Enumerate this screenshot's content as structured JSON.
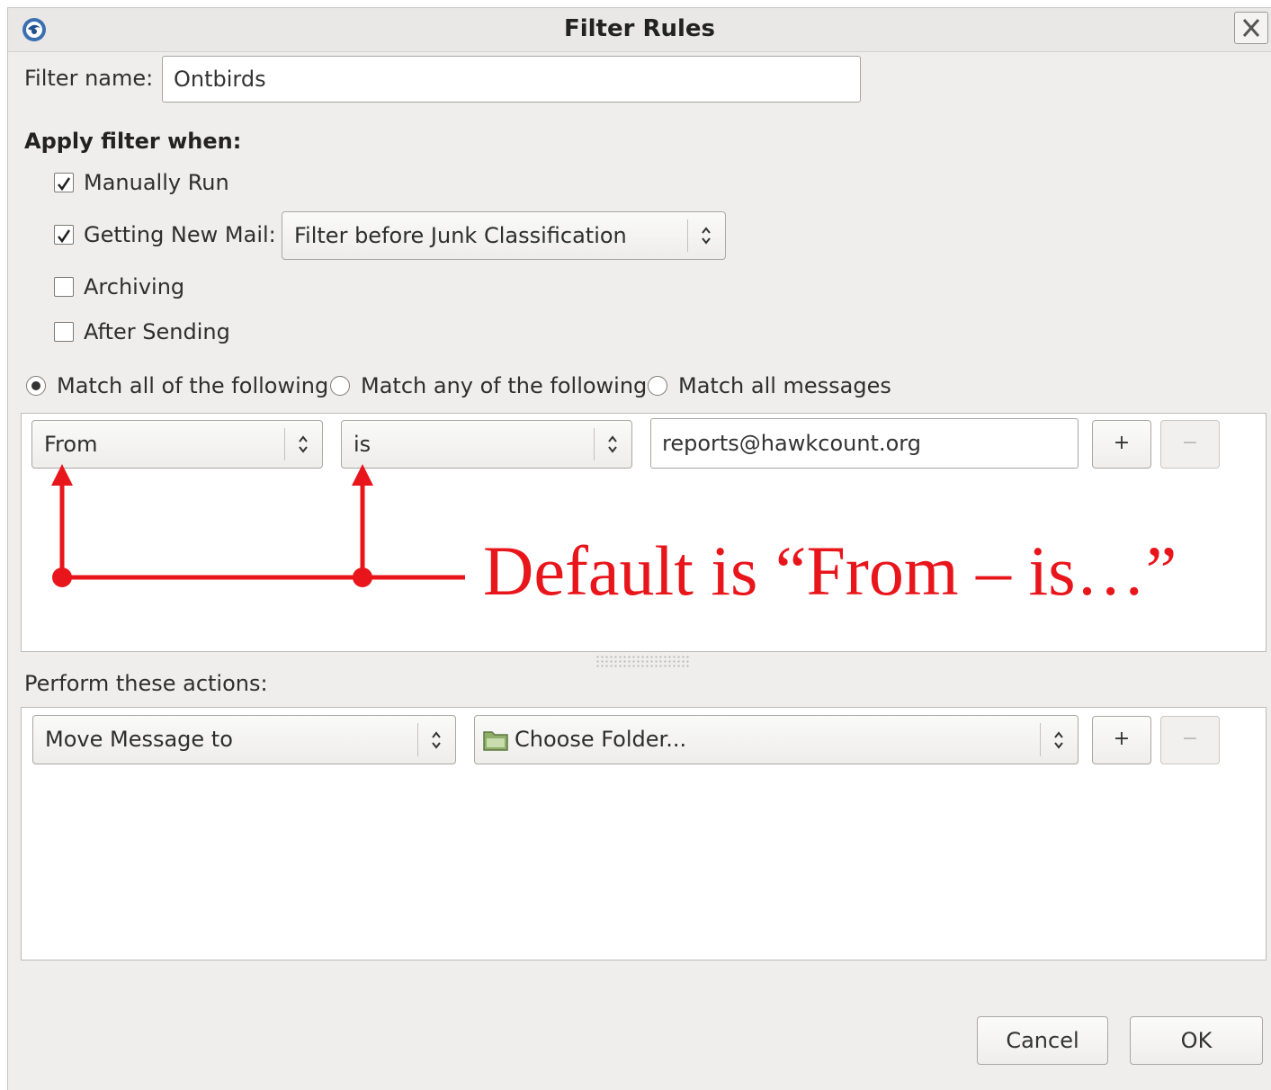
{
  "window": {
    "title": "Filter Rules"
  },
  "filter_name": {
    "label": "Filter name:",
    "value": "Ontbirds"
  },
  "apply_when": {
    "heading": "Apply filter when:",
    "manually_run": {
      "label": "Manually Run",
      "checked": true
    },
    "getting_new_mail": {
      "label": "Getting New Mail:",
      "checked": true,
      "option": "Filter before Junk Classification"
    },
    "archiving": {
      "label": "Archiving",
      "checked": false
    },
    "after_sending": {
      "label": "After Sending",
      "checked": false
    }
  },
  "match": {
    "all": "Match all of the following",
    "any": "Match any of the following",
    "all_messages": "Match all messages",
    "selected": "all"
  },
  "rule": {
    "field": "From",
    "operator": "is",
    "value": "reports@hawkcount.org",
    "add_label": "+",
    "remove_label": "−"
  },
  "annotation": {
    "text": "Default is “From – is…”",
    "color": "#e8151b"
  },
  "actions": {
    "label": "Perform these actions:",
    "action": "Move Message to",
    "target": "Choose Folder...",
    "add_label": "+",
    "remove_label": "−"
  },
  "buttons": {
    "cancel": "Cancel",
    "ok": "OK"
  },
  "icons": {
    "app": "thunderbird-icon",
    "close": "close-icon",
    "folder": "folder-icon",
    "spin": "updown-arrows-icon"
  }
}
